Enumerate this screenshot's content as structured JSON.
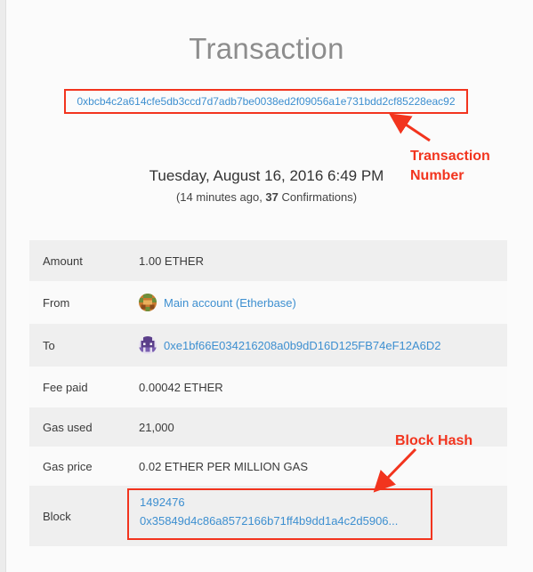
{
  "page_title": "Transaction",
  "transaction_hash": "0xbcb4c2a614cfe5db3ccd7d7adb7be0038ed2f09056a1e731bdd2cf85228eac92",
  "date": "Tuesday, August 16, 2016 6:49 PM",
  "relative": {
    "open": "(14 minutes ago, ",
    "confirmations": "37",
    "close": " Confirmations)"
  },
  "details": {
    "amount": {
      "label": "Amount",
      "value": "1.00 ETHER"
    },
    "from": {
      "label": "From",
      "value": "Main account (Etherbase)",
      "icon": "identicon-icon"
    },
    "to": {
      "label": "To",
      "value": "0xe1bf66E034216208a0b9dD16D125FB74eF12A6D2",
      "icon": "identicon-icon"
    },
    "fee_paid": {
      "label": "Fee paid",
      "value": "0.00042 ETHER"
    },
    "gas_used": {
      "label": "Gas used",
      "value": "21,000"
    },
    "gas_price": {
      "label": "Gas price",
      "value": "0.02 ETHER PER MILLION GAS"
    },
    "block": {
      "label": "Block",
      "number": "1492476",
      "hash": "0x35849d4c86a8572166b71ff4b9dd1a4c2d5906..."
    }
  },
  "annotations": {
    "transaction_number_line1": "Transaction",
    "transaction_number_line2": "Number",
    "block_hash": "Block Hash"
  },
  "colors": {
    "accent_link": "#3d8fd0",
    "annotation_red": "#f2341e",
    "row_alt": "#efefef"
  }
}
